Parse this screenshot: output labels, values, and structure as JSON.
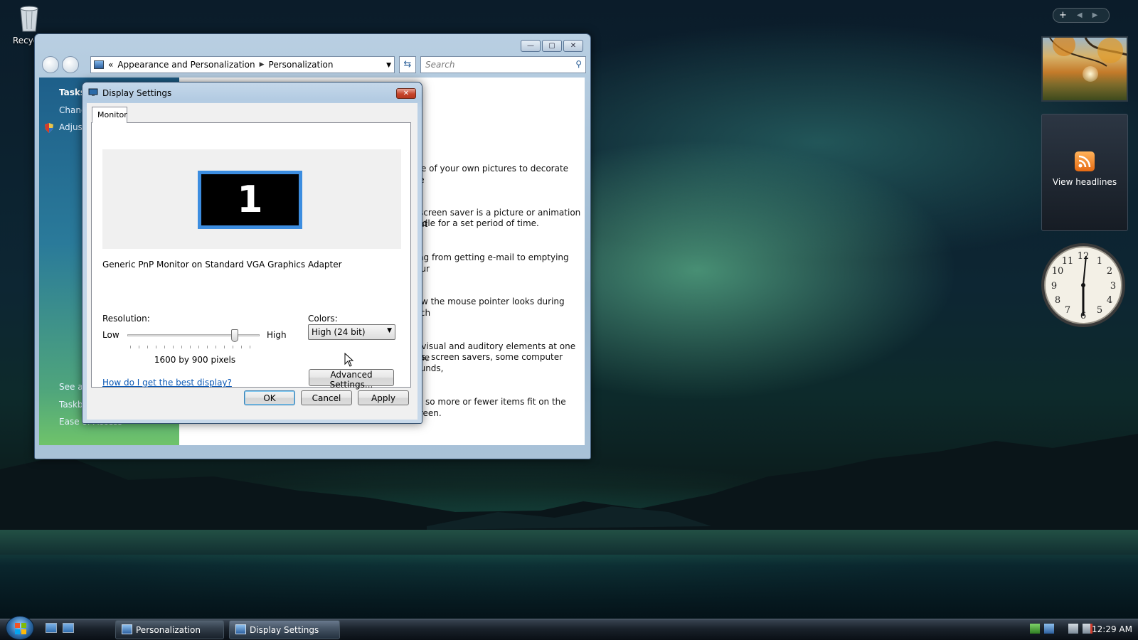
{
  "desktop": {
    "recycle_bin_label": "Recycle"
  },
  "explorer": {
    "breadcrumb": {
      "back_chevrons": "«",
      "items": [
        "Appearance and Personalization",
        "Personalization"
      ]
    },
    "search_placeholder": "Search",
    "left_pane": {
      "tasks_heading": "Tasks",
      "items": [
        "Chang",
        "Adjust"
      ],
      "see_also": [
        "See al",
        "Taskb",
        "Ease of Access"
      ]
    },
    "content_snippets": [
      "one of your own pictures to decorate the",
      "A screen saver is a picture or animation that",
      "is idle for a set period of time.",
      "hing from getting e-mail to emptying your",
      "how the mouse pointer looks during such",
      "of visual and auditory elements at one time",
      "nds, screen savers, some computer sounds,",
      "ew so more or fewer items fit on the screen."
    ]
  },
  "dialog": {
    "title": "Display Settings",
    "tab_label": "Monitor",
    "monitor_number": "1",
    "monitor_name": "Generic PnP Monitor on Standard VGA Graphics Adapter",
    "resolution_label": "Resolution:",
    "slider_low": "Low",
    "slider_high": "High",
    "slider_value_fraction": 0.81,
    "resolution_value": "1600 by 900 pixels",
    "colors_label": "Colors:",
    "colors_value": "High (24 bit)",
    "help_link": "How do I get the best display?",
    "advanced_button": "Advanced Settings...",
    "ok_button": "OK",
    "cancel_button": "Cancel",
    "apply_button": "Apply"
  },
  "sidebar": {
    "feed_label": "View headlines"
  },
  "taskbar": {
    "items": [
      "Personalization",
      "Display Settings"
    ],
    "time": "12:29 AM"
  },
  "colors": {
    "accent": "#3c8de0",
    "link": "#0a58b5",
    "close_red": "#c6452b"
  }
}
